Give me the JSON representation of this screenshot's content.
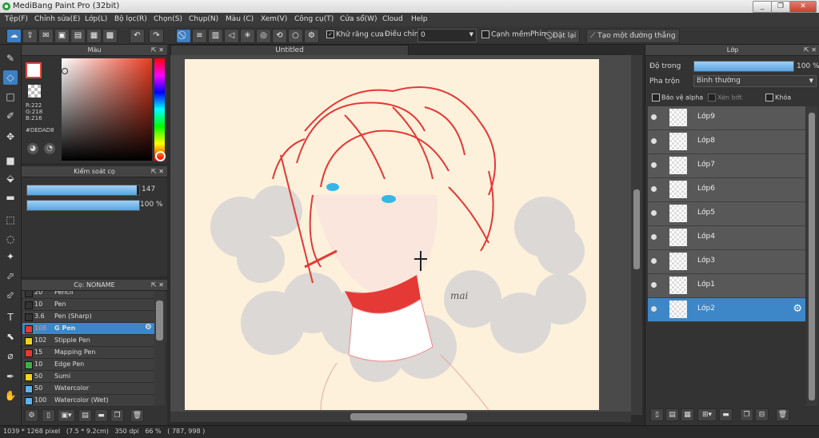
{
  "window": {
    "title": "MediBang Paint Pro (32bit)",
    "minimize": "_",
    "restore": "❐",
    "close": "✕"
  },
  "menu": [
    "Tệp(F)",
    "Chỉnh sửa(E)",
    "Lớp(L)",
    "Bộ lọc(R)",
    "Chọn(S)",
    "Chụp(N)",
    "Màu (C)",
    "Xem(V)",
    "Công cụ(T)",
    "Cửa sổ(W)",
    "Cloud",
    "Help"
  ],
  "toolbar": {
    "antialias_label": "Khử răng cưa",
    "adjust_label": "Điều chỉnh",
    "adjust_value": "0",
    "edge_label": "Cạnh mềm",
    "key_label": "Phím",
    "reset_label": "Đặt lại",
    "create_line_label": "Tạo một đường thẳng"
  },
  "color_panel": {
    "title": "Màu",
    "r": "R:222",
    "g": "G:218",
    "b": "B:216",
    "hex": "#DEDAD8",
    "primary_color": "#DEDAD8",
    "accent": "#e8463a"
  },
  "brush_control": {
    "title": "Kiểm soát cọ",
    "size": "147",
    "opacity": "100 %",
    "size_fraction": 0.98,
    "opacity_fraction": 1.0
  },
  "brush_panel": {
    "title": "Cọ: NONAME",
    "items": [
      {
        "size": "20",
        "name": "Pencil",
        "color": "#333333"
      },
      {
        "size": "10",
        "name": "Pen",
        "color": "#333333"
      },
      {
        "size": "3.6",
        "name": "Pen (Sharp)",
        "color": "#333333"
      },
      {
        "size": "108",
        "name": "G Pen",
        "color": "#e53935",
        "selected": true
      },
      {
        "size": "102",
        "name": "Stipple Pen",
        "color": "#f2d21b"
      },
      {
        "size": "15",
        "name": "Mapping Pen",
        "color": "#e53935"
      },
      {
        "size": "10",
        "name": "Edge Pen",
        "color": "#3cb043"
      },
      {
        "size": "50",
        "name": "Sumi",
        "color": "#f2d21b"
      },
      {
        "size": "50",
        "name": "Watercolor",
        "color": "#5ab4f0"
      },
      {
        "size": "100",
        "name": "Watercolor (Wet)",
        "color": "#5ab4f0"
      }
    ]
  },
  "canvas": {
    "tab_title": "Untitled",
    "signature": "mai"
  },
  "layer_panel": {
    "title": "Lớp",
    "opacity_label": "Độ trong",
    "opacity_value": "100 %",
    "blend_label": "Pha trộn",
    "blend_value": "Bình thường",
    "protect_alpha": "Bảo vệ alpha",
    "clipping": "Xén bớt",
    "lock": "Khóa",
    "layers": [
      {
        "name": "Lớp9"
      },
      {
        "name": "Lớp8"
      },
      {
        "name": "Lớp7"
      },
      {
        "name": "Lớp6"
      },
      {
        "name": "Lớp5"
      },
      {
        "name": "Lớp4"
      },
      {
        "name": "Lớp3"
      },
      {
        "name": "Lớp1"
      },
      {
        "name": "Lớp2",
        "selected": true
      }
    ]
  },
  "status": {
    "text": "1039 * 1268 pixel   (7.5 * 9.2cm)   350 dpi   66 %   ( 787, 998 )"
  }
}
